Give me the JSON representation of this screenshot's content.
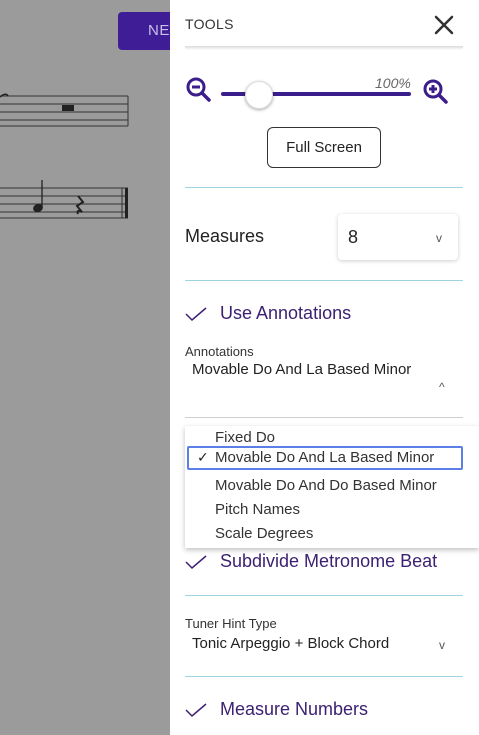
{
  "background": {
    "new_button_label": "NE"
  },
  "drawer": {
    "title": "TOOLS",
    "zoom": {
      "value_label": "100%",
      "slider_fraction": 0.2
    },
    "full_screen_label": "Full Screen",
    "measures": {
      "label": "Measures",
      "value": "8"
    },
    "use_annotations": {
      "label": "Use Annotations",
      "checked": true
    },
    "annotations": {
      "caption": "Annotations",
      "value": "Movable Do And La Based Minor",
      "options": [
        "Fixed Do",
        "Movable Do And La Based Minor",
        "Movable Do And Do Based Minor",
        "Pitch Names",
        "Scale Degrees"
      ],
      "selected_check": "✓"
    },
    "subdivide_metronome": {
      "label": "Subdivide Metronome Beat",
      "checked": true
    },
    "tuner_hint": {
      "caption": "Tuner Hint Type",
      "value": "Tonic Arpeggio + Block Chord"
    },
    "measure_numbers": {
      "label": "Measure Numbers",
      "checked": true
    }
  },
  "colors": {
    "accent": "#3c1d8c",
    "label_purple": "#3c2172",
    "divider": "#9fd2e0",
    "focus": "#5b7fe6"
  }
}
